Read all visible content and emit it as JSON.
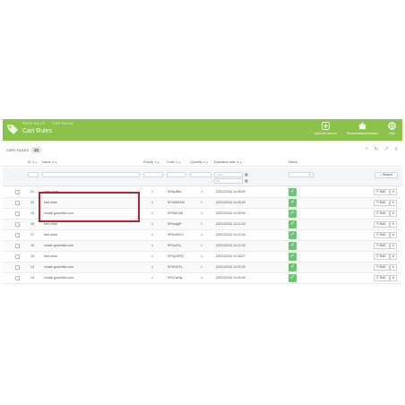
{
  "header": {
    "breadcrumb": [
      "PRICE RULES",
      "CART RULES"
    ],
    "title": "Cart Rules",
    "buttons": [
      {
        "label": "Add new cart rule",
        "icon": "plus-circle-icon"
      },
      {
        "label": "Recommended Modules",
        "icon": "puzzle-icon"
      },
      {
        "label": "Help",
        "icon": "help-lifebuoy-icon"
      }
    ],
    "bg_color": "#8bc34a"
  },
  "list": {
    "heading": "CART RULES",
    "count": "21",
    "tools": [
      "add-icon",
      "refresh-icon",
      "export-icon",
      "database-icon"
    ]
  },
  "table": {
    "columns": {
      "id": "ID",
      "name": "Name",
      "priority": "Priority",
      "code": "Code",
      "quantity": "Quantity",
      "expiration": "Expiration date",
      "status": "Status"
    },
    "filters": {
      "from_placeholder": "From",
      "to_placeholder": "To",
      "status_value": "-",
      "search_label": "Search"
    },
    "rows": [
      {
        "id": "21",
        "name": "New order",
        "priority": "1",
        "code": "SHtqJBla",
        "quantity": "1",
        "expiration": "03/21/2016 14:26:00"
      },
      {
        "id": "20",
        "name": "first order",
        "priority": "1",
        "code": "SPn5bKSM",
        "quantity": "1",
        "expiration": "03/21/2016 14:26:00"
      },
      {
        "id": "19",
        "name": "create.godzhilot.com",
        "priority": "1",
        "code": "SP25rC6B",
        "quantity": "1",
        "expiration": "03/21/2016 14:25:00"
      },
      {
        "id": "18",
        "name": "first order",
        "priority": "1",
        "code": "SPxaqkjP",
        "quantity": "1",
        "expiration": "03/21/2016 14:22:34"
      },
      {
        "id": "17",
        "name": "first order",
        "priority": "1",
        "code": "SPhYMSYl",
        "quantity": "1",
        "expiration": "03/21/2016 14:22:34"
      },
      {
        "id": "16",
        "name": "create.godzhilot.com",
        "priority": "1",
        "code": "SPvxcFty",
        "quantity": "1",
        "expiration": "03/21/2016 14:22:34"
      },
      {
        "id": "15",
        "name": "first order",
        "priority": "1",
        "code": "SPXjUEFQ",
        "quantity": "1",
        "expiration": "03/21/2016 14:18:27"
      },
      {
        "id": "14",
        "name": "create.godzhilot.com",
        "priority": "1",
        "code": "SPb3rDTy",
        "quantity": "1",
        "expiration": "03/21/2016 14:20:00"
      },
      {
        "id": "13",
        "name": "create.godzhilot.com",
        "priority": "1",
        "code": "SPu7aehy",
        "quantity": "1",
        "expiration": "03/21/2016 14:20:00"
      }
    ],
    "edit_label": "Edit",
    "status_color": "#72c279"
  },
  "highlight_color": "#b3262d"
}
